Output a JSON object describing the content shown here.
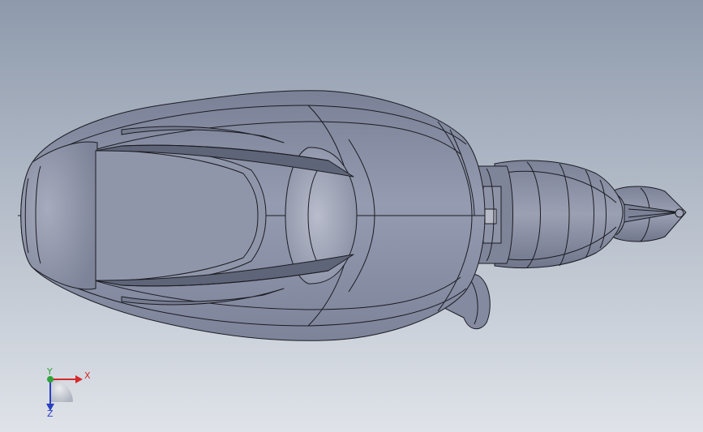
{
  "viewport": {
    "background_top": "#8e9aac",
    "background_bottom": "#dfe3e9",
    "model_fill": "#8c93a8",
    "model_highlight": "#aeb3c3",
    "model_shadow": "#6f7589",
    "edge_color": "#1b1c22"
  },
  "triad": {
    "x_label": "X",
    "y_label": "Y",
    "z_label": "Z",
    "x_color": "#d42a2a",
    "y_color": "#2fa33a",
    "z_color": "#2b3fc2"
  }
}
